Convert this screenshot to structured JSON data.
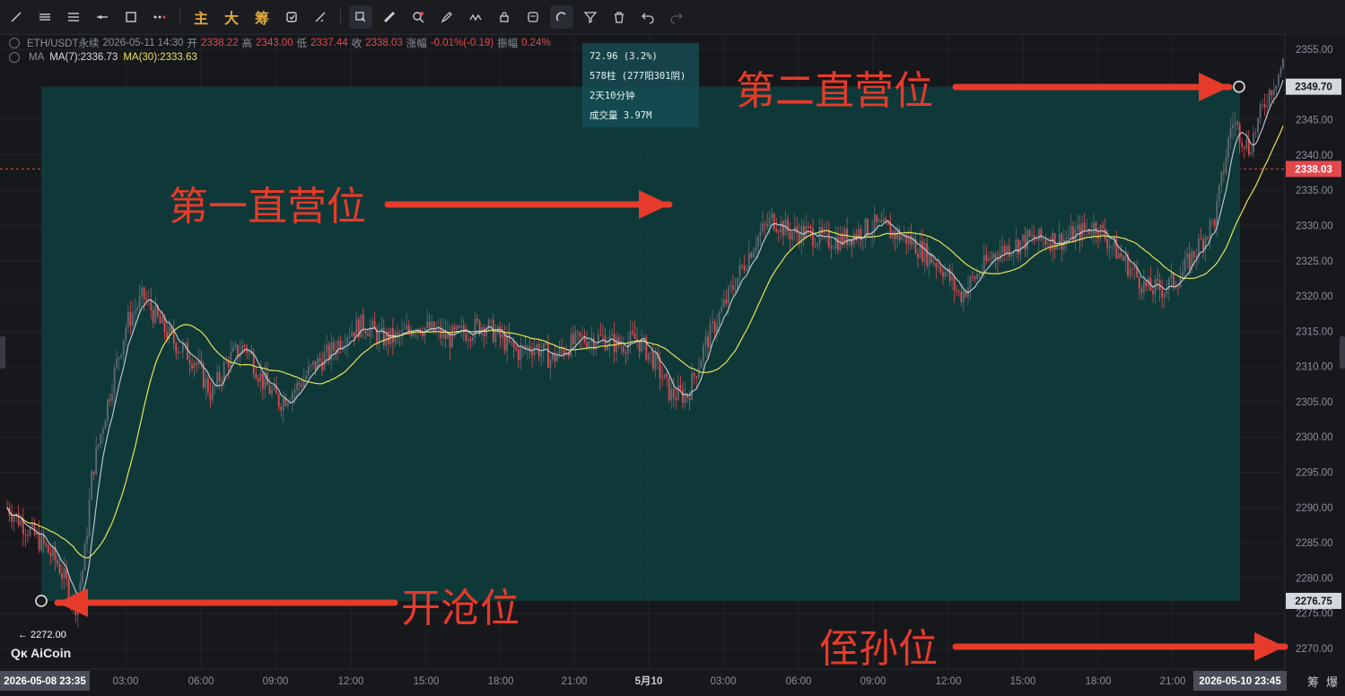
{
  "toolbar": {
    "tools": [
      "line-tool",
      "hline-tool",
      "parallel-tool",
      "ray-tool",
      "rect-tool",
      "more-tool"
    ],
    "text_buttons": [
      "主",
      "大",
      "筹"
    ],
    "tools2": [
      "sync-tool",
      "measure-tool",
      "ruler-tool",
      "zoom-tool",
      "brush-tool",
      "pattern-tool",
      "lock-tool",
      "template-tool",
      "magnet-tool",
      "filter-tool",
      "delete-tool",
      "undo-tool",
      "redo-tool"
    ]
  },
  "legend": {
    "symbol": "ETH/USDT永续",
    "datetime": "2026-05-11 14:30",
    "open_label": "开",
    "open": "2338.22",
    "high_label": "高",
    "high": "2343.00",
    "low_label": "低",
    "low": "2337.44",
    "close_label": "收",
    "close": "2338.03",
    "change_label": "涨幅",
    "change": "-0.01%(-0.19)",
    "amp_label": "振幅",
    "amp": "0.24%",
    "ma_title": "MA",
    "ma7": "MA(7):2336.73",
    "ma30": "MA(30):2333.63"
  },
  "tooltip": {
    "line1": "72.96 (3.2%)",
    "line2": "578柱 (277阳301阴)",
    "line3": "2天10分钟",
    "line4": "成交量 3.97M"
  },
  "bottom_right": [
    "筹",
    "爆"
  ],
  "logo_text": "AiCoin",
  "chart_data": {
    "type": "candlestick",
    "symbol": "ETH/USDT永续",
    "ylim": [
      2266,
      2358
    ],
    "y_ticks": [
      "2355.00",
      "2345.00",
      "2340.00",
      "2335.00",
      "2330.00",
      "2325.00",
      "2320.00",
      "2315.00",
      "2310.00",
      "2305.00",
      "2300.00",
      "2295.00",
      "2290.00",
      "2285.00",
      "2280.00",
      "2275.00",
      "2270.00"
    ],
    "x_ticks": [
      "03:00",
      "06:00",
      "09:00",
      "12:00",
      "15:00",
      "18:00",
      "21:00",
      "5月10",
      "03:00",
      "06:00",
      "09:00",
      "12:00",
      "15:00",
      "18:00",
      "21:00"
    ],
    "x_start_label": "2026-05-08 23:35",
    "x_end_label": "2026-05-10 23:45",
    "price_markers": [
      {
        "label": "2349.70",
        "value": 2349.7,
        "style": "light"
      },
      {
        "label": "2338.03",
        "value": 2338.03,
        "style": "red"
      },
      {
        "label": "2276.75",
        "value": 2276.75,
        "style": "light"
      }
    ],
    "low_marker": "← 2272.00",
    "low_value": 2272.0,
    "measure_box": {
      "from": 2276.75,
      "to": 2349.7
    },
    "close_path": [
      [
        0,
        2290
      ],
      [
        2,
        2285
      ],
      [
        3,
        2282
      ],
      [
        4,
        2276
      ],
      [
        4.5,
        2282
      ],
      [
        5,
        2295
      ],
      [
        6,
        2306
      ],
      [
        7,
        2316
      ],
      [
        8,
        2320
      ],
      [
        9,
        2316
      ],
      [
        10,
        2313
      ],
      [
        11,
        2311
      ],
      [
        12,
        2306
      ],
      [
        13,
        2311
      ],
      [
        14,
        2313
      ],
      [
        15,
        2308
      ],
      [
        16,
        2305
      ],
      [
        17,
        2307
      ],
      [
        18,
        2310
      ],
      [
        19,
        2312
      ],
      [
        20,
        2315
      ],
      [
        21,
        2316
      ],
      [
        22,
        2314
      ],
      [
        23,
        2314
      ],
      [
        24,
        2316
      ],
      [
        25,
        2315
      ],
      [
        26,
        2314
      ],
      [
        27,
        2315
      ],
      [
        28,
        2316
      ],
      [
        29,
        2314
      ],
      [
        30,
        2312
      ],
      [
        31,
        2313
      ],
      [
        32,
        2311
      ],
      [
        33,
        2313
      ],
      [
        34,
        2314
      ],
      [
        35,
        2314
      ],
      [
        36,
        2313
      ],
      [
        37,
        2314
      ],
      [
        38,
        2311
      ],
      [
        39,
        2306
      ],
      [
        40,
        2306
      ],
      [
        41,
        2313
      ],
      [
        42,
        2318
      ],
      [
        43,
        2323
      ],
      [
        44,
        2328
      ],
      [
        45,
        2331
      ],
      [
        46,
        2329
      ],
      [
        47,
        2329
      ],
      [
        48,
        2328
      ],
      [
        49,
        2328
      ],
      [
        50,
        2329
      ],
      [
        51,
        2330
      ],
      [
        52,
        2329
      ],
      [
        53,
        2328
      ],
      [
        54,
        2326
      ],
      [
        55,
        2324
      ],
      [
        56,
        2320
      ],
      [
        57,
        2323
      ],
      [
        58,
        2326
      ],
      [
        59,
        2327
      ],
      [
        60,
        2328
      ],
      [
        61,
        2328
      ],
      [
        62,
        2328
      ],
      [
        63,
        2329
      ],
      [
        64,
        2330
      ],
      [
        65,
        2327
      ],
      [
        66,
        2324
      ],
      [
        67,
        2321
      ],
      [
        68,
        2321
      ],
      [
        69,
        2323
      ],
      [
        70,
        2327
      ],
      [
        71,
        2331
      ],
      [
        72,
        2345
      ],
      [
        73,
        2341
      ],
      [
        74,
        2348
      ],
      [
        75,
        2353
      ]
    ],
    "ma7_label": "MA(7)",
    "ma30_label": "MA(30)",
    "colors": {
      "up": "#5f6a73",
      "down": "#e3484d",
      "ma7": "#d8dce6",
      "ma30": "#e9e15a",
      "box": "#0f3b3a"
    }
  },
  "annotations": [
    {
      "text": "第二直营位",
      "target": "second-point"
    },
    {
      "text": "第一直营位",
      "target": "first-point"
    },
    {
      "text": "开沧位",
      "target": "open-point"
    },
    {
      "text": "侄孙位",
      "target": "axis-point"
    }
  ]
}
